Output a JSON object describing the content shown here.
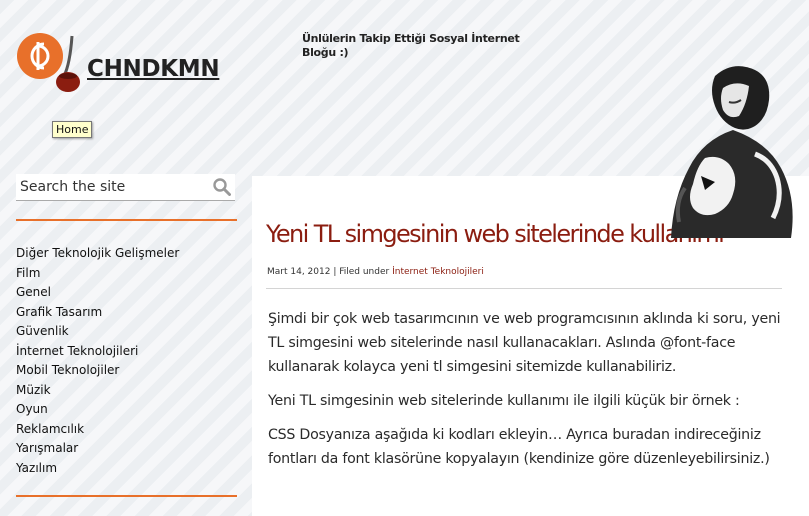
{
  "site": {
    "logo_text": "CHNDKMN",
    "tagline": "Ünlülerin Takip Ettiği Sosyal İnternet Bloğu :)",
    "home_tooltip": "Home"
  },
  "search": {
    "placeholder": "Search the site",
    "icon": "search-icon"
  },
  "sidebar": {
    "categories": [
      "Diğer Teknolojik Gelişmeler",
      "Film",
      "Genel",
      "Grafik Tasarım",
      "Güvenlik",
      "İnternet Teknolojileri",
      "Mobil Teknolojiler",
      "Müzik",
      "Oyun",
      "Reklamcılık",
      "Yarışmalar",
      "Yazılım"
    ]
  },
  "post": {
    "title": "Yeni TL simgesinin web sitelerinde kullanımı",
    "date": "Mart 14, 2012",
    "filed_under": "| Filed under",
    "category": "İnternet Teknolojileri",
    "paragraphs": [
      "Şimdi bir çok web tasarımcının ve web programcısının aklında ki soru, yeni TL simgesini web sitelerinde nasıl kullanacakları. Aslında @font-face kullanarak kolayca yeni tl simgesini sitemizde kullanabiliriz.",
      "Yeni TL simgesinin web sitelerinde kullanımı ile ilgili küçük bir örnek :",
      "CSS Dosyanıza aşağıda ki kodları ekleyin… Ayrıca buradan indireceğiniz fontları da font klasörüne kopyalayın (kendinize göre düzenleyebilirsiniz.)"
    ]
  },
  "colors": {
    "accent": "#e8702a",
    "title": "#8b1d10",
    "tooltip_bg": "#ffffcc"
  }
}
